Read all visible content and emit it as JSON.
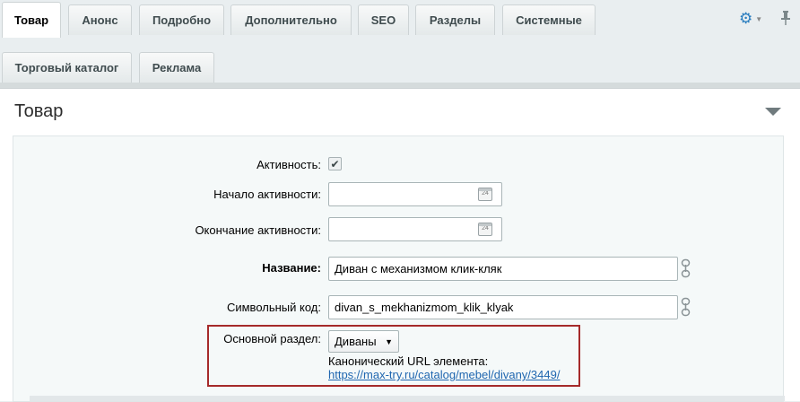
{
  "tabs_row1": [
    {
      "label": "Товар",
      "active": true
    },
    {
      "label": "Анонс"
    },
    {
      "label": "Подробно"
    },
    {
      "label": "Дополнительно"
    },
    {
      "label": "SEO"
    },
    {
      "label": "Разделы"
    },
    {
      "label": "Системные"
    }
  ],
  "tabs_row2": [
    {
      "label": "Торговый каталог"
    },
    {
      "label": "Реклама"
    }
  ],
  "toolbar": {
    "settings_icon": "gear-icon",
    "pin_icon": "pin-icon"
  },
  "section": {
    "title": "Товар"
  },
  "form": {
    "active_label": "Активность:",
    "active_checked": true,
    "start_label": "Начало активности:",
    "start_value": "",
    "end_label": "Окончание активности:",
    "end_value": "",
    "calendar_icon_text": "24",
    "name_label": "Название:",
    "name_value": "Диван с механизмом клик-кляк",
    "code_label": "Символьный код:",
    "code_value": "divan_s_mekhanizmom_klik_klyak",
    "section_label": "Основной раздел:",
    "section_value": "Диваны",
    "canonical_label": "Канонический URL элемента:",
    "canonical_url": "https://max-try.ru/catalog/mebel/divany/3449/"
  },
  "colors": {
    "accent": "#2a7dbf",
    "highlight_border": "#a52a2a",
    "link": "#2067b0"
  }
}
